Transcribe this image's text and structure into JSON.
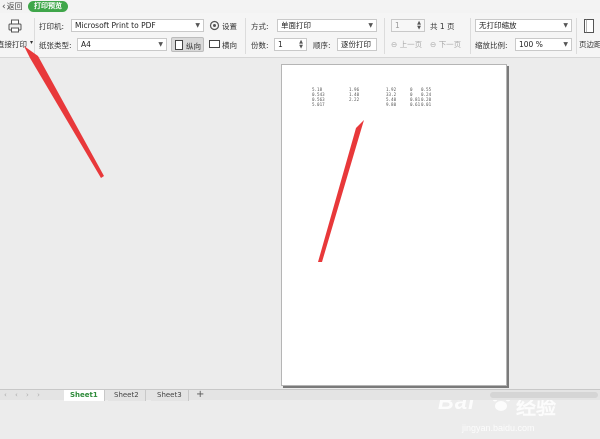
{
  "topbar": {
    "back_label": "返回",
    "preview_tab": "打印预览"
  },
  "toolbar": {
    "direct_print": "直接打印",
    "printer_label": "打印机:",
    "printer_value": "Microsoft Print to PDF",
    "settings_label": "设置",
    "paper_label": "纸张类型:",
    "paper_value": "A4",
    "portrait_label": "纵向",
    "landscape_label": "横向",
    "mode_label": "方式:",
    "mode_value": "单面打印",
    "copies_label": "份数:",
    "copies_value": "1",
    "order_label": "顺序:",
    "order_value": "逐份打印",
    "page_value": "1",
    "total_pages": "共 1 页",
    "prev_page": "上一页",
    "next_page": "下一页",
    "scale_mode": "无打印缩放",
    "zoom_label": "缩放比例:",
    "zoom_value": "100 %",
    "margin_label": "页边距"
  },
  "page_content": {
    "rows": [
      [
        "5.18",
        "1.96",
        "1.92",
        "0",
        "0.55"
      ],
      [
        "0.543",
        "1.40",
        "33.2",
        "0",
        "0.24"
      ],
      [
        "0.563",
        "2.22",
        "5.40",
        "0.81",
        "0.20"
      ],
      [
        "5.017",
        "",
        "9.80",
        "0.61",
        "0.01"
      ]
    ]
  },
  "sheets": {
    "tabs": [
      "Sheet1",
      "Sheet2",
      "Sheet3"
    ],
    "add": "+"
  },
  "watermark": {
    "brand": "Bai",
    "brand2": "经验",
    "url": "jingyan.baidu.com"
  },
  "colors": {
    "accent_green": "#3fa64a",
    "arrow_red": "#e8383a"
  }
}
